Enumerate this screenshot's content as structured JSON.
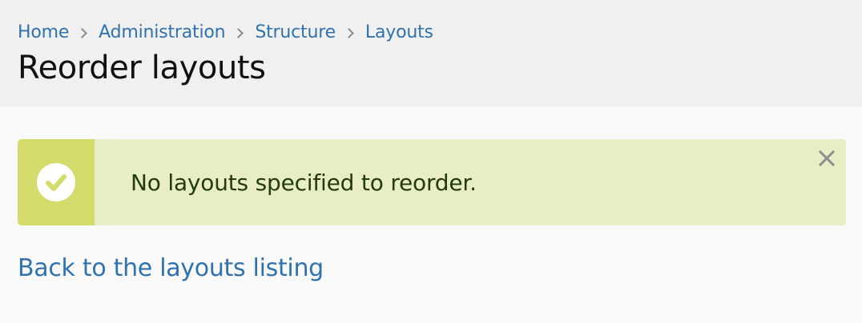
{
  "breadcrumb": {
    "items": [
      {
        "label": "Home"
      },
      {
        "label": "Administration"
      },
      {
        "label": "Structure"
      },
      {
        "label": "Layouts"
      }
    ]
  },
  "page": {
    "title": "Reorder layouts"
  },
  "message": {
    "text": "No layouts specified to reorder.",
    "type": "success",
    "icon": "check-circle-icon",
    "close_icon": "close-icon",
    "colors": {
      "background": "#e8edc5",
      "icon_bar": "#d3db6b",
      "text": "#233b10"
    }
  },
  "links": {
    "back_label": "Back to the layouts listing"
  },
  "colors": {
    "link": "#2f72ad",
    "header_background": "#f0f0f0",
    "page_background": "#f9f9f9"
  }
}
